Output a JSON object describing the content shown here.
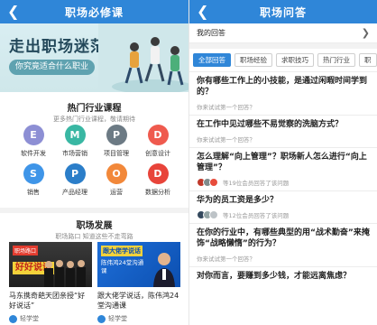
{
  "left": {
    "nav_title": "职场必修课",
    "back_icon": "chevron-left-icon",
    "banner": {
      "title": "走出职场迷茫",
      "subtitle": "你究竟适合什么职业"
    },
    "hot_section": {
      "title": "热门行业课程",
      "subtitle": "更多热门行业课程，敬请期待"
    },
    "courses": [
      {
        "letter": "E",
        "label": "软件开发",
        "color": "#8d8fd4"
      },
      {
        "letter": "M",
        "label": "市场营销",
        "color": "#39b7a3"
      },
      {
        "letter": "P",
        "label": "项目管理",
        "color": "#6c7a84"
      },
      {
        "letter": "D",
        "label": "创意设计",
        "color": "#ef5a4e"
      },
      {
        "letter": "S",
        "label": "销售",
        "color": "#3f95e8"
      },
      {
        "letter": "P",
        "label": "产品经理",
        "color": "#2b7ec9"
      },
      {
        "letter": "O",
        "label": "运营",
        "color": "#f2883a"
      },
      {
        "letter": "D",
        "label": "数据分析",
        "color": "#e8443a"
      }
    ],
    "career_section": {
      "title": "职场发展",
      "subtitle": "职场路口 知道这些不走弯路"
    },
    "cards": [
      {
        "thumb_tag": "职场路口",
        "thumb_big": "好好说话",
        "title": "马东携奇葩天团亲授“好好说话”",
        "meta": "轻学堂"
      },
      {
        "thumb_tag": "跟大佬学说话",
        "thumb_text": "陈伟鸿24堂沟通课",
        "title": "跟大佬学说话，陈伟鸿24堂沟通课",
        "meta": "轻学堂"
      }
    ]
  },
  "right": {
    "nav_title": "职场问答",
    "back_icon": "chevron-left-icon",
    "my_answers": "我的回答",
    "tabs": [
      "全部回答",
      "职场经验",
      "求职技巧",
      "热门行业",
      "职"
    ],
    "questions": [
      {
        "title": "你有哪些工作上的小技能，是通过闲暇时间学到的？",
        "hint": "你来试试第一个回答？"
      },
      {
        "title": "在工作中见过哪些不易觉察的洗脑方式？",
        "hint": "你来试试第一个回答？"
      },
      {
        "title": "怎么理解“向上管理”？职场新人怎么进行“向上管理”？",
        "count": "等19位会员回答了该问题"
      },
      {
        "title": "华为的员工资是多少？",
        "count": "等12位会员回答了该问题"
      },
      {
        "title": "在你的行业中，有哪些典型的用“战术勤奋”来掩饰“战略懒惰”的行为？",
        "hint": "你来试试第一个回答？"
      },
      {
        "title": "对你而言，要赚到多少钱，才能远离焦虑？"
      }
    ]
  }
}
